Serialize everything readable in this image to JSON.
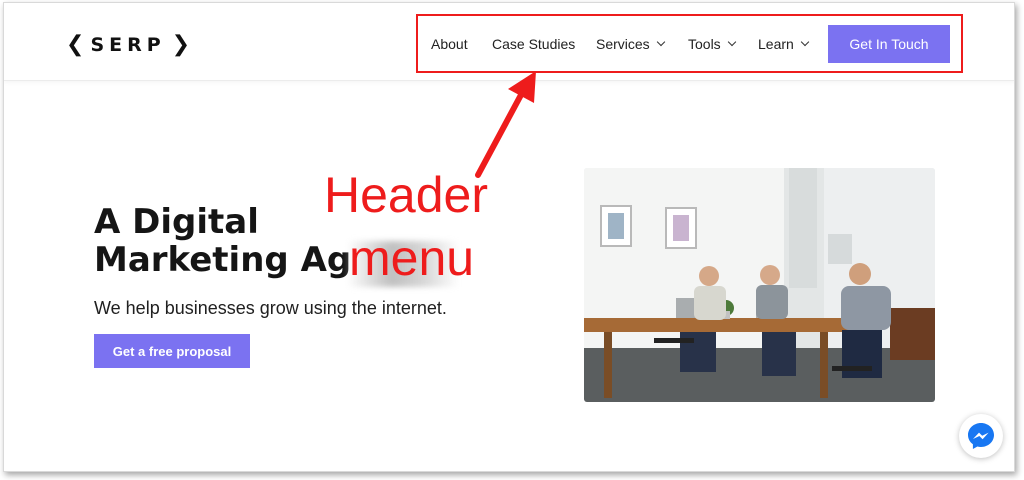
{
  "header": {
    "logo_text": "SERP",
    "nav": {
      "about": "About",
      "case_studies": "Case Studies",
      "services": "Services",
      "tools": "Tools",
      "learn": "Learn",
      "cta": "Get In Touch"
    }
  },
  "hero": {
    "title_line1": "A Digital",
    "title_line2": "Marketing Ag",
    "subtitle": "We help businesses grow using the internet.",
    "button_label": "Get a free proposal"
  },
  "annotation": {
    "word1": "Header",
    "word2": "menu"
  },
  "icons": {
    "logo_left": "chevron-left-icon",
    "logo_right": "chevron-right-icon",
    "dropdown": "chevron-down-icon",
    "chat": "messenger-icon"
  },
  "colors": {
    "accent": "#7b72f1",
    "annotation": "#ee1c1c",
    "messenger": "#1877f2"
  }
}
